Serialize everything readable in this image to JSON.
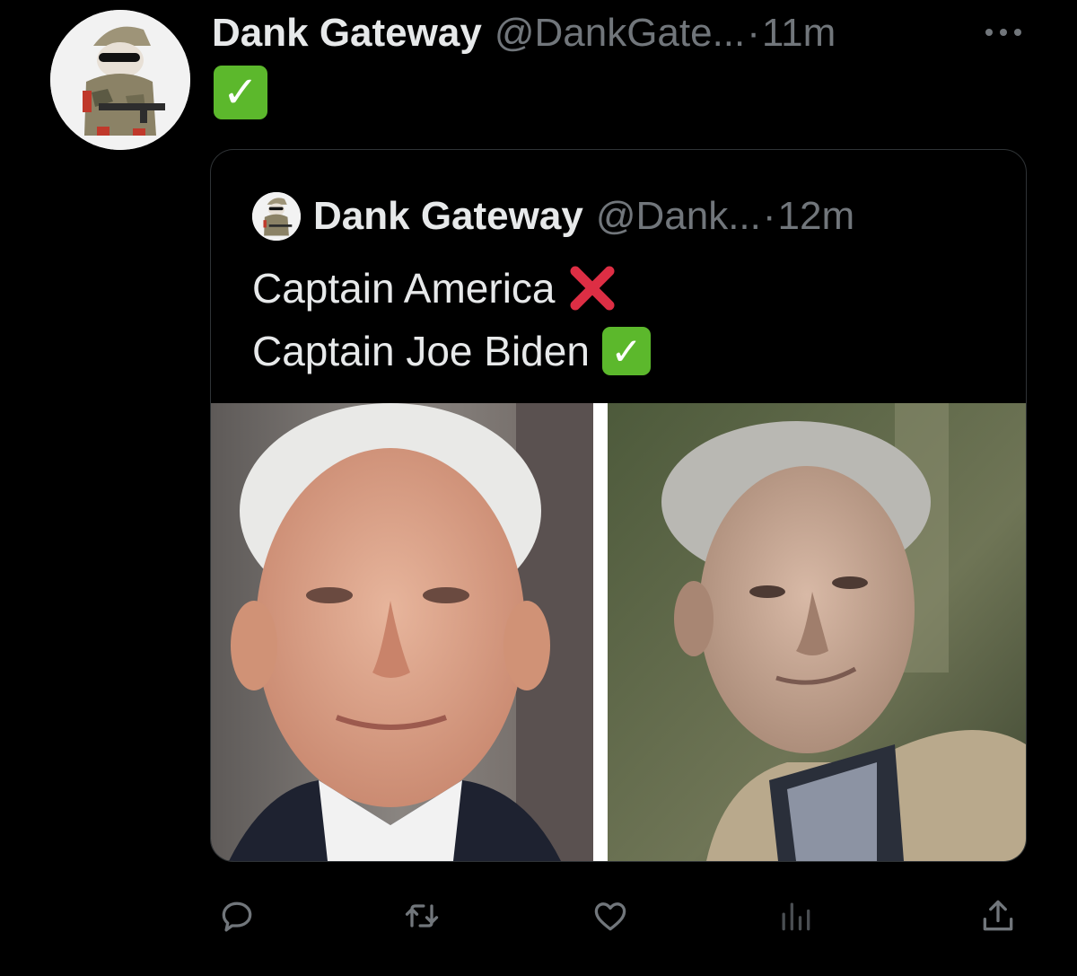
{
  "tweet": {
    "display_name": "Dank Gateway",
    "handle": "@DankGate...",
    "separator": "·",
    "time": "11m",
    "body_emoji": "✓"
  },
  "quoted": {
    "display_name": "Dank Gateway",
    "handle": "@Dank...",
    "separator": "·",
    "time": "12m",
    "line1": "Captain America",
    "line2": "Captain Joe Biden",
    "line2_emoji": "✓"
  },
  "actions": {
    "reply_icon": "reply-icon",
    "retweet_icon": "retweet-icon",
    "like_icon": "heart-icon",
    "views_icon": "views-icon",
    "share_icon": "share-icon"
  },
  "colors": {
    "background": "#000000",
    "text_primary": "#e7e9ea",
    "text_secondary": "#71767b",
    "check_green": "#5cb82c",
    "cross_red": "#dd2e44"
  }
}
